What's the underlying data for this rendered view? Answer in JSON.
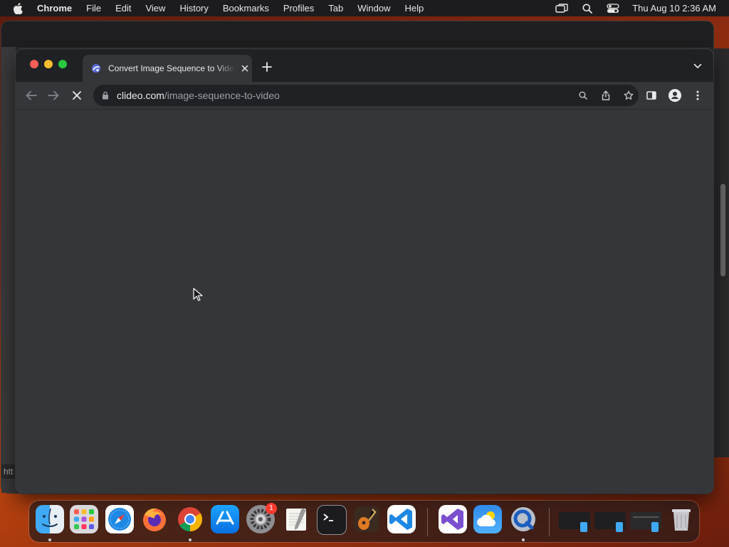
{
  "menubar": {
    "app_name": "Chrome",
    "items": [
      "File",
      "Edit",
      "View",
      "History",
      "Bookmarks",
      "Profiles",
      "Tab",
      "Window",
      "Help"
    ],
    "clock": "Thu Aug 10  2:36 AM"
  },
  "background_window": {
    "status_text": "htt"
  },
  "browser": {
    "tab": {
      "title": "Convert Image Sequence to Video",
      "favicon": "clideo-favicon"
    },
    "url": {
      "host": "clideo.com",
      "path": "/image-sequence-to-video"
    },
    "toolbar": {
      "back_icon": "arrow-left-icon",
      "forward_icon": "arrow-right-icon",
      "stop_icon": "close-icon"
    }
  },
  "dock": {
    "apps": [
      {
        "name": "Finder",
        "running": true
      },
      {
        "name": "Launchpad",
        "running": false
      },
      {
        "name": "Safari",
        "running": false
      },
      {
        "name": "Firefox",
        "running": false
      },
      {
        "name": "Google Chrome",
        "running": true
      },
      {
        "name": "App Store",
        "running": false
      },
      {
        "name": "System Preferences",
        "running": false,
        "badge": "1"
      },
      {
        "name": "TextEdit",
        "running": false
      },
      {
        "name": "Terminal",
        "running": false
      },
      {
        "name": "GarageBand",
        "running": false
      },
      {
        "name": "Visual Studio Code",
        "running": false
      },
      {
        "name": "Visual Studio",
        "running": false
      },
      {
        "name": "Weather",
        "running": false
      },
      {
        "name": "QuickTime Player",
        "running": true
      }
    ]
  },
  "colors": {
    "menubar_bg": "#1c1c1e",
    "chrome_frame": "#202124",
    "chrome_toolbar": "#35363a",
    "omnibox_bg": "#202124"
  }
}
